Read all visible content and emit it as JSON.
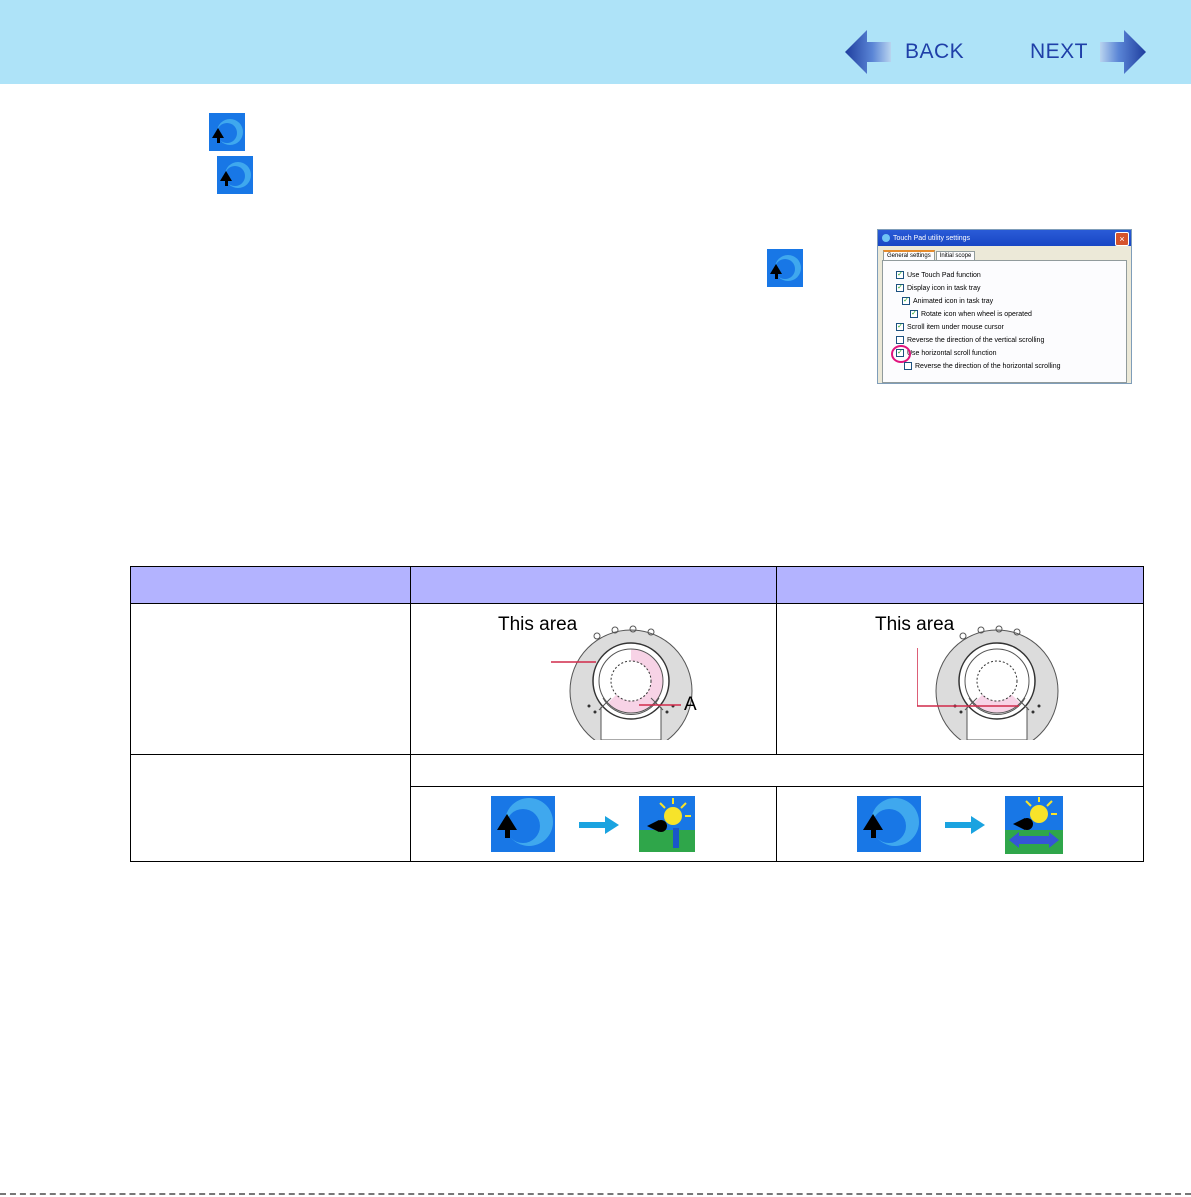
{
  "header": {
    "back_label": "BACK",
    "next_label": "NEXT",
    "background_color": "#aee3f8",
    "label_color": "#1f3fa8"
  },
  "icons": {
    "utility_icon": "touch-pad-utility-icon",
    "before_icon": "touch-pad-utility-icon",
    "vertical_scroll_icon": "vertical-scroll-icon",
    "horizontal_scroll_icon": "horizontal-scroll-icon",
    "arrow_icon": "arrow-right-icon"
  },
  "dialog": {
    "title": "Touch Pad utility settings",
    "close_label": "×",
    "tabs": [
      "General settings",
      "Initial scope"
    ],
    "options": [
      {
        "label": "Use Touch Pad function",
        "checked": true
      },
      {
        "label": "Display icon in task tray",
        "checked": true
      },
      {
        "label": "Animated icon in task tray",
        "checked": true
      },
      {
        "label": "Rotate icon when wheel is operated",
        "checked": true
      },
      {
        "label": "Scroll item under mouse cursor",
        "checked": true
      },
      {
        "label": "Reverse the direction of the vertical scrolling",
        "checked": false
      },
      {
        "label": "Use horizontal scroll function",
        "checked": true
      },
      {
        "label": "Reverse the direction of the horizontal scrolling",
        "checked": false
      }
    ],
    "highlight_color": "#e0147e"
  },
  "table": {
    "header_color": "#b3b3ff",
    "vertical": {
      "area_label": "This area",
      "marker": "A"
    },
    "horizontal": {
      "area_label": "This area"
    },
    "highlight_color": "#f7d3e6"
  }
}
